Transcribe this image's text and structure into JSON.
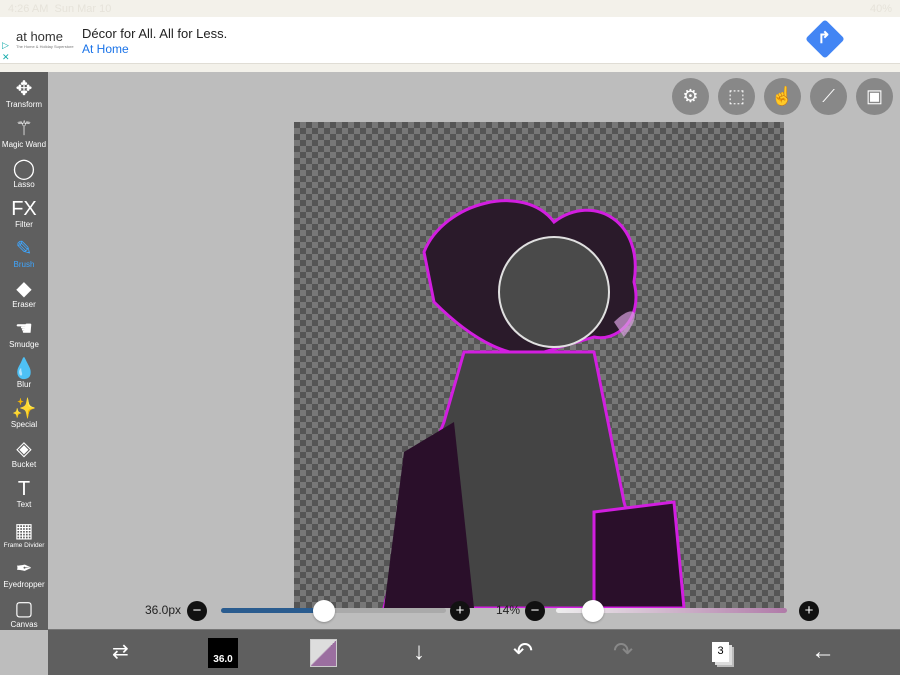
{
  "status": {
    "time": "4:26 AM",
    "date": "Sun Mar 10",
    "battery": "40%"
  },
  "ad": {
    "logo": "at home",
    "logo_tagline": "The Home & Holiday Superstore",
    "title": "Décor for All. All for Less.",
    "advertiser": "At Home"
  },
  "tools": [
    {
      "label": "Transform",
      "icon": "move-icon",
      "glyph": "✥"
    },
    {
      "label": "Magic Wand",
      "icon": "magic-wand-icon",
      "glyph": "⚚"
    },
    {
      "label": "Lasso",
      "icon": "lasso-icon",
      "glyph": "◯"
    },
    {
      "label": "Filter",
      "icon": "fx-icon",
      "glyph": "FX"
    },
    {
      "label": "Brush",
      "icon": "brush-icon",
      "glyph": "✎",
      "active": true
    },
    {
      "label": "Eraser",
      "icon": "eraser-icon",
      "glyph": "◆"
    },
    {
      "label": "Smudge",
      "icon": "smudge-icon",
      "glyph": "☚"
    },
    {
      "label": "Blur",
      "icon": "blur-icon",
      "glyph": "💧"
    },
    {
      "label": "Special",
      "icon": "special-icon",
      "glyph": "✨"
    },
    {
      "label": "Bucket",
      "icon": "bucket-icon",
      "glyph": "◈"
    },
    {
      "label": "Text",
      "icon": "text-icon",
      "glyph": "T"
    },
    {
      "label": "Frame Divider",
      "icon": "frame-divider-icon",
      "glyph": "▦"
    },
    {
      "label": "Eyedropper",
      "icon": "eyedropper-icon",
      "glyph": "✒"
    },
    {
      "label": "Canvas",
      "icon": "canvas-icon",
      "glyph": "▢"
    }
  ],
  "brush": {
    "size_label": "36.0px",
    "size_value": 36.0,
    "size_fraction": 0.47,
    "opacity_label": "14%",
    "opacity_percent": 14,
    "swatch_label": "36.0",
    "accent": "#2a5c8f",
    "color": "#9b6fa0"
  },
  "bottom": {
    "layers_count": "3"
  }
}
